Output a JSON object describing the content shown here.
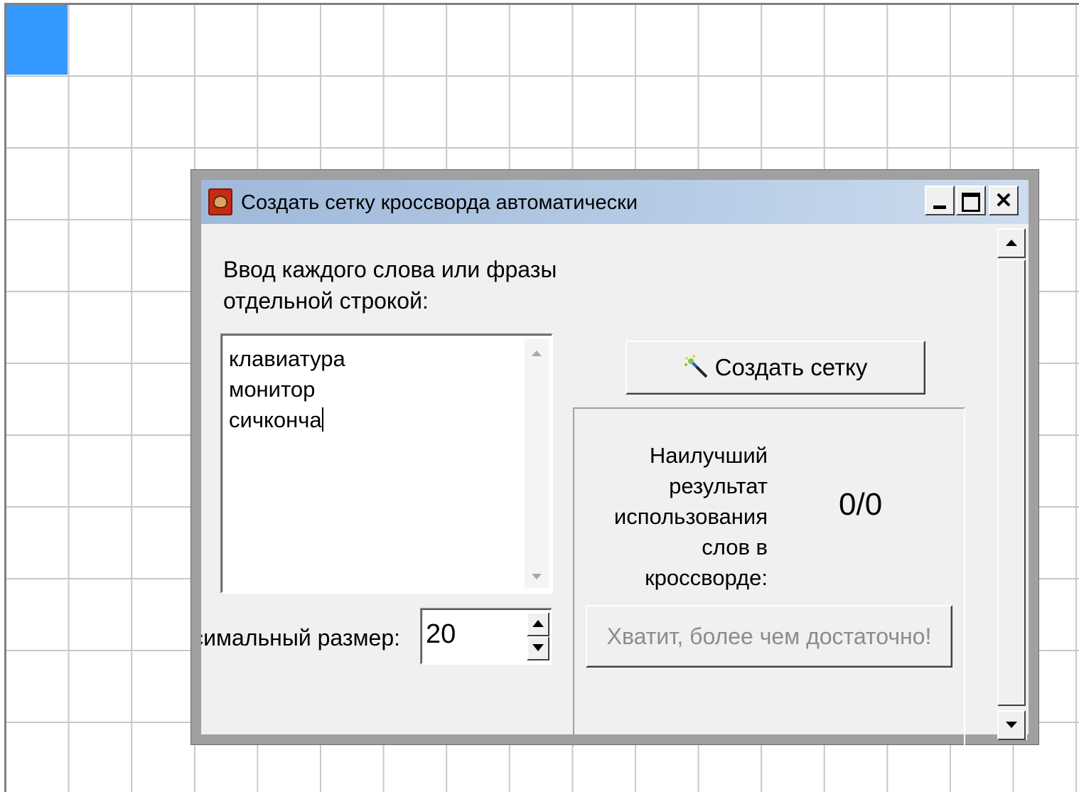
{
  "window": {
    "title": "Создать сетку кроссворда автоматически"
  },
  "form": {
    "prompt": "Ввод каждого слова или фразы отдельной строкой:",
    "words": [
      "клавиатура",
      "монитор",
      "сичконча"
    ],
    "size_label": "Максимальный размер:",
    "size_value": "20"
  },
  "actions": {
    "create_label": "Создать сетку",
    "stop_label": "Хватит, более чем достаточно!"
  },
  "results": {
    "best_label": "Наилучший результат использования слов в кроссворде:",
    "score": "0/0"
  },
  "colors": {
    "selected_cell": "#3399ff",
    "title_gradient_start": "#9fb9d9",
    "title_gradient_end": "#cddcee"
  },
  "icons": {
    "app": "crossword-app-icon",
    "wand": "magic-wand-icon"
  }
}
